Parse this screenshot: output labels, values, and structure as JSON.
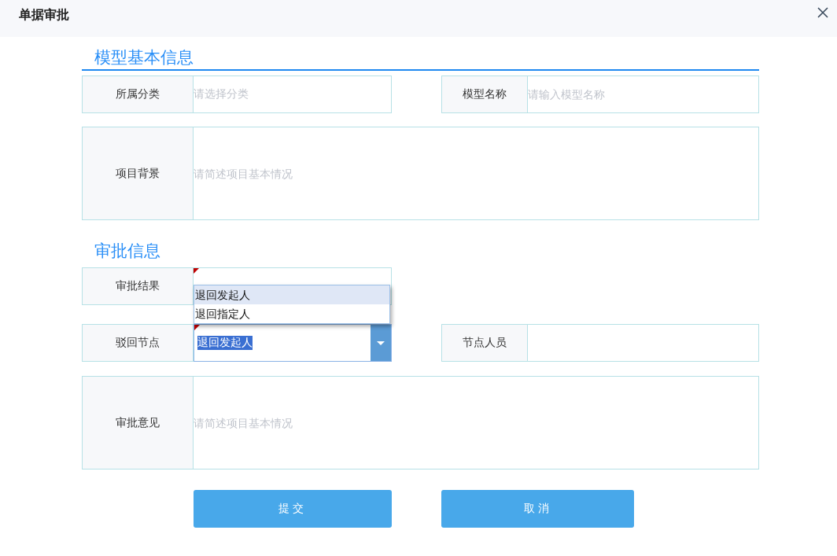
{
  "dialog": {
    "title": "单据审批"
  },
  "sections": [
    {
      "title": "模型基本信息",
      "underline": true,
      "rows": [
        {
          "fields": [
            {
              "kind": "select",
              "label": "所属分类",
              "placeholder": "请选择分类"
            },
            {
              "kind": "input",
              "label": "模型名称",
              "placeholder": "请输入模型名称"
            }
          ]
        },
        {
          "fields": [
            {
              "kind": "textarea",
              "label": "项目背景",
              "placeholder": "请简述项目基本情况"
            }
          ]
        }
      ]
    },
    {
      "title": "审批信息",
      "underline": false,
      "rows": [
        {
          "fields": [
            {
              "kind": "select",
              "label": "审批结果",
              "required": true,
              "options": [
                {
                  "label": "退回发起人",
                  "selected": true
                },
                {
                  "label": "退回指定人",
                  "selected": false
                }
              ]
            }
          ]
        },
        {
          "fields": [
            {
              "kind": "combo",
              "label": "驳回节点",
              "required": true,
              "value": "退回发起人",
              "value_selected": true
            },
            {
              "kind": "input",
              "label": "节点人员"
            }
          ]
        },
        {
          "fields": [
            {
              "kind": "textarea",
              "label": "审批意见",
              "placeholder": "请简述项目基本情况"
            }
          ]
        }
      ]
    }
  ],
  "buttons": [
    "提交",
    "取消"
  ]
}
